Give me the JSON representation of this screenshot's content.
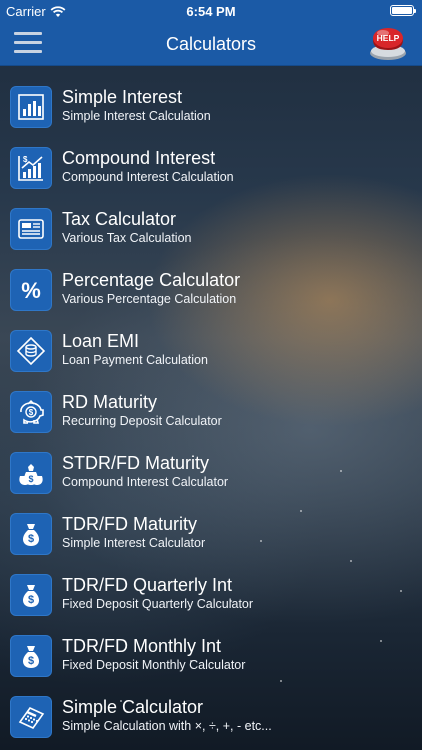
{
  "status": {
    "carrier": "Carrier",
    "time": "6:54 PM"
  },
  "nav": {
    "title": "Calculators",
    "help_label": "HELP"
  },
  "items": [
    {
      "title": "Simple Interest",
      "subtitle": "Simple Interest Calculation",
      "icon": "bar-chart-icon"
    },
    {
      "title": "Compound Interest",
      "subtitle": "Compound Interest Calculation",
      "icon": "growth-chart-icon"
    },
    {
      "title": "Tax Calculator",
      "subtitle": "Various Tax Calculation",
      "icon": "tax-document-icon"
    },
    {
      "title": "Percentage Calculator",
      "subtitle": "Various Percentage Calculation",
      "icon": "percent-icon"
    },
    {
      "title": "Loan EMI",
      "subtitle": "Loan Payment Calculation",
      "icon": "loan-icon"
    },
    {
      "title": "RD Maturity",
      "subtitle": "Recurring Deposit Calculator",
      "icon": "piggy-bank-icon"
    },
    {
      "title": "STDR/FD Maturity",
      "subtitle": "Compound Interest Calculator",
      "icon": "money-bags-icon"
    },
    {
      "title": "TDR/FD Maturity",
      "subtitle": "Simple Interest Calculator",
      "icon": "money-bag-icon"
    },
    {
      "title": "TDR/FD Quarterly Int",
      "subtitle": "Fixed Deposit Quarterly Calculator",
      "icon": "money-bag-icon"
    },
    {
      "title": "TDR/FD Monthly Int",
      "subtitle": "Fixed Deposit Monthly Calculator",
      "icon": "money-bag-icon"
    },
    {
      "title": "Simple Calculator",
      "subtitle": "Simple Calculation with ×, ÷, +, - etc...",
      "icon": "calculator-icon"
    }
  ],
  "colors": {
    "bar": "#1b5aa6",
    "icon_bg": "#1e63b4",
    "help_red": "#d8262a"
  }
}
